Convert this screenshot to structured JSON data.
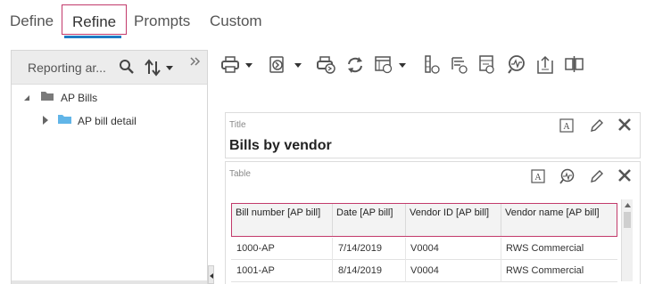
{
  "tabs": [
    {
      "label": "Define"
    },
    {
      "label": "Refine"
    },
    {
      "label": "Prompts"
    },
    {
      "label": "Custom"
    }
  ],
  "left_panel": {
    "title": "Reporting ar...",
    "tree": [
      {
        "label": "AP Bills",
        "icon": "folder-icon"
      },
      {
        "label": "AP bill detail",
        "icon": "folder-icon"
      }
    ]
  },
  "toolbar": {
    "icons": [
      "print-icon",
      "export-icon",
      "print-preview-icon",
      "refresh-icon",
      "view-icon",
      "row-icon",
      "group-icon",
      "aggregate-icon",
      "analyze-icon",
      "upload-icon",
      "column-icon"
    ]
  },
  "title_panel": {
    "small_label": "Title",
    "heading": "Bills by vendor",
    "icons": [
      "text-style-icon",
      "edit-icon",
      "close-icon"
    ]
  },
  "table_panel": {
    "small_label": "Table",
    "icons": [
      "text-style-icon",
      "analyze-icon",
      "edit-icon",
      "close-icon"
    ],
    "columns": [
      "Bill number [AP bill]",
      "Date [AP bill]",
      "Vendor ID [AP bill]",
      "Vendor name [AP bill]"
    ],
    "rows": [
      [
        "1000-AP",
        "7/14/2019",
        "V0004",
        "RWS Commercial"
      ],
      [
        "1001-AP",
        "8/14/2019",
        "V0004",
        "RWS Commercial"
      ]
    ]
  },
  "colors": {
    "accent": "#1e7bc4",
    "highlight": "#c23a6b"
  }
}
